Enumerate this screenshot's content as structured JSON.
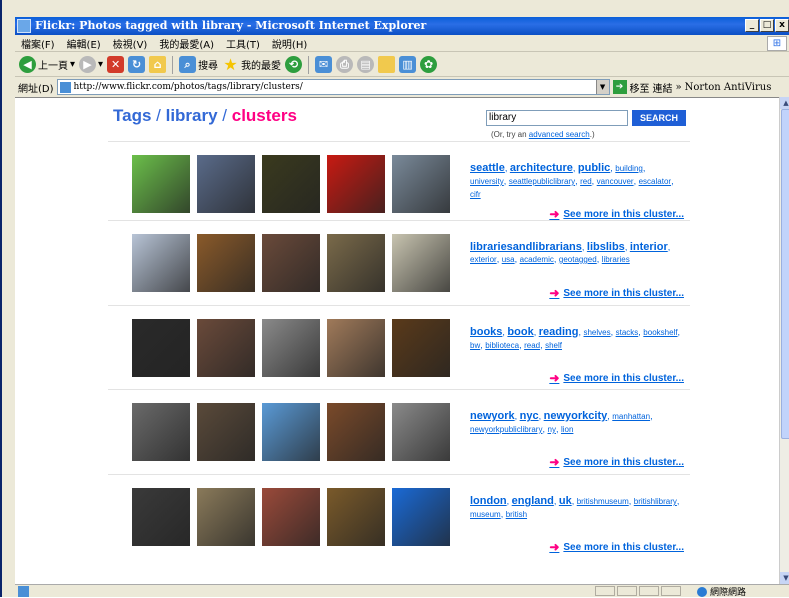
{
  "window": {
    "title": "Flickr: Photos tagged with library - Microsoft Internet Explorer",
    "buttons": [
      "_",
      "□",
      "x"
    ]
  },
  "menubar": {
    "items": [
      "檔案(F)",
      "編輯(E)",
      "檢視(V)",
      "我的最愛(A)",
      "工具(T)",
      "說明(H)"
    ]
  },
  "toolbar": {
    "back_label": "上一頁",
    "search_label": "搜尋",
    "favorites_label": "我的最愛"
  },
  "addressbar": {
    "label": "網址(D)",
    "url": "http://www.flickr.com/photos/tags/library/clusters/",
    "go_label": "移至",
    "links_label": "連結",
    "norton_label": "Norton AntiVirus"
  },
  "statusbar": {
    "zone_label": "網際網路"
  },
  "page": {
    "heading": {
      "tags": "Tags",
      "sep1": " / ",
      "library": "library",
      "sep2": " / ",
      "clusters": "clusters"
    },
    "search": {
      "value": "library",
      "button_label": "SEARCH",
      "hint_prefix": "(Or, try an ",
      "hint_link": "advanced search",
      "hint_suffix": ".)"
    },
    "see_more_label": "See more in this cluster...",
    "clusters": [
      {
        "big_tags": [
          "seattle",
          "architecture",
          "public"
        ],
        "small_tags": [
          "building",
          "university",
          "seattlepubliclibrary",
          "red",
          "vancouver",
          "escalator",
          "cifr"
        ],
        "thumb_colors": [
          "#6bbf4a",
          "#5a6b8a",
          "#3a3a1e",
          "#c81a12",
          "#7a8a9a"
        ]
      },
      {
        "big_tags": [
          "librariesandlibrarians",
          "libslibs",
          "interior"
        ],
        "small_tags": [
          "exterior",
          "usa",
          "academic",
          "geotagged",
          "libraries"
        ],
        "thumb_colors": [
          "#b8c4d6",
          "#8a5a2a",
          "#6a4a3a",
          "#7a6a4a",
          "#c8c4b0"
        ]
      },
      {
        "big_tags": [
          "books",
          "book",
          "reading"
        ],
        "small_tags": [
          "shelves",
          "stacks",
          "bookshelf",
          "bw",
          "biblioteca",
          "read",
          "shelf"
        ],
        "thumb_colors": [
          "#2a2a2a",
          "#6a4a3a",
          "#8a8a8a",
          "#a07a5a",
          "#5a3a1a"
        ]
      },
      {
        "big_tags": [
          "newyork",
          "nyc",
          "newyorkcity"
        ],
        "small_tags": [
          "manhattan",
          "newyorkpubliclibrary",
          "ny",
          "lion"
        ],
        "thumb_colors": [
          "#6a6a6a",
          "#5a4a3a",
          "#5a9ad6",
          "#7a4a2a",
          "#8a8a8a"
        ]
      },
      {
        "big_tags": [
          "london",
          "england",
          "uk"
        ],
        "small_tags": [
          "britishmuseum",
          "britishlibrary",
          "museum",
          "british"
        ],
        "thumb_colors": [
          "#3a3a3a",
          "#8a7a5a",
          "#9a4a3a",
          "#7a5a2a",
          "#1a6ad6"
        ]
      }
    ]
  }
}
